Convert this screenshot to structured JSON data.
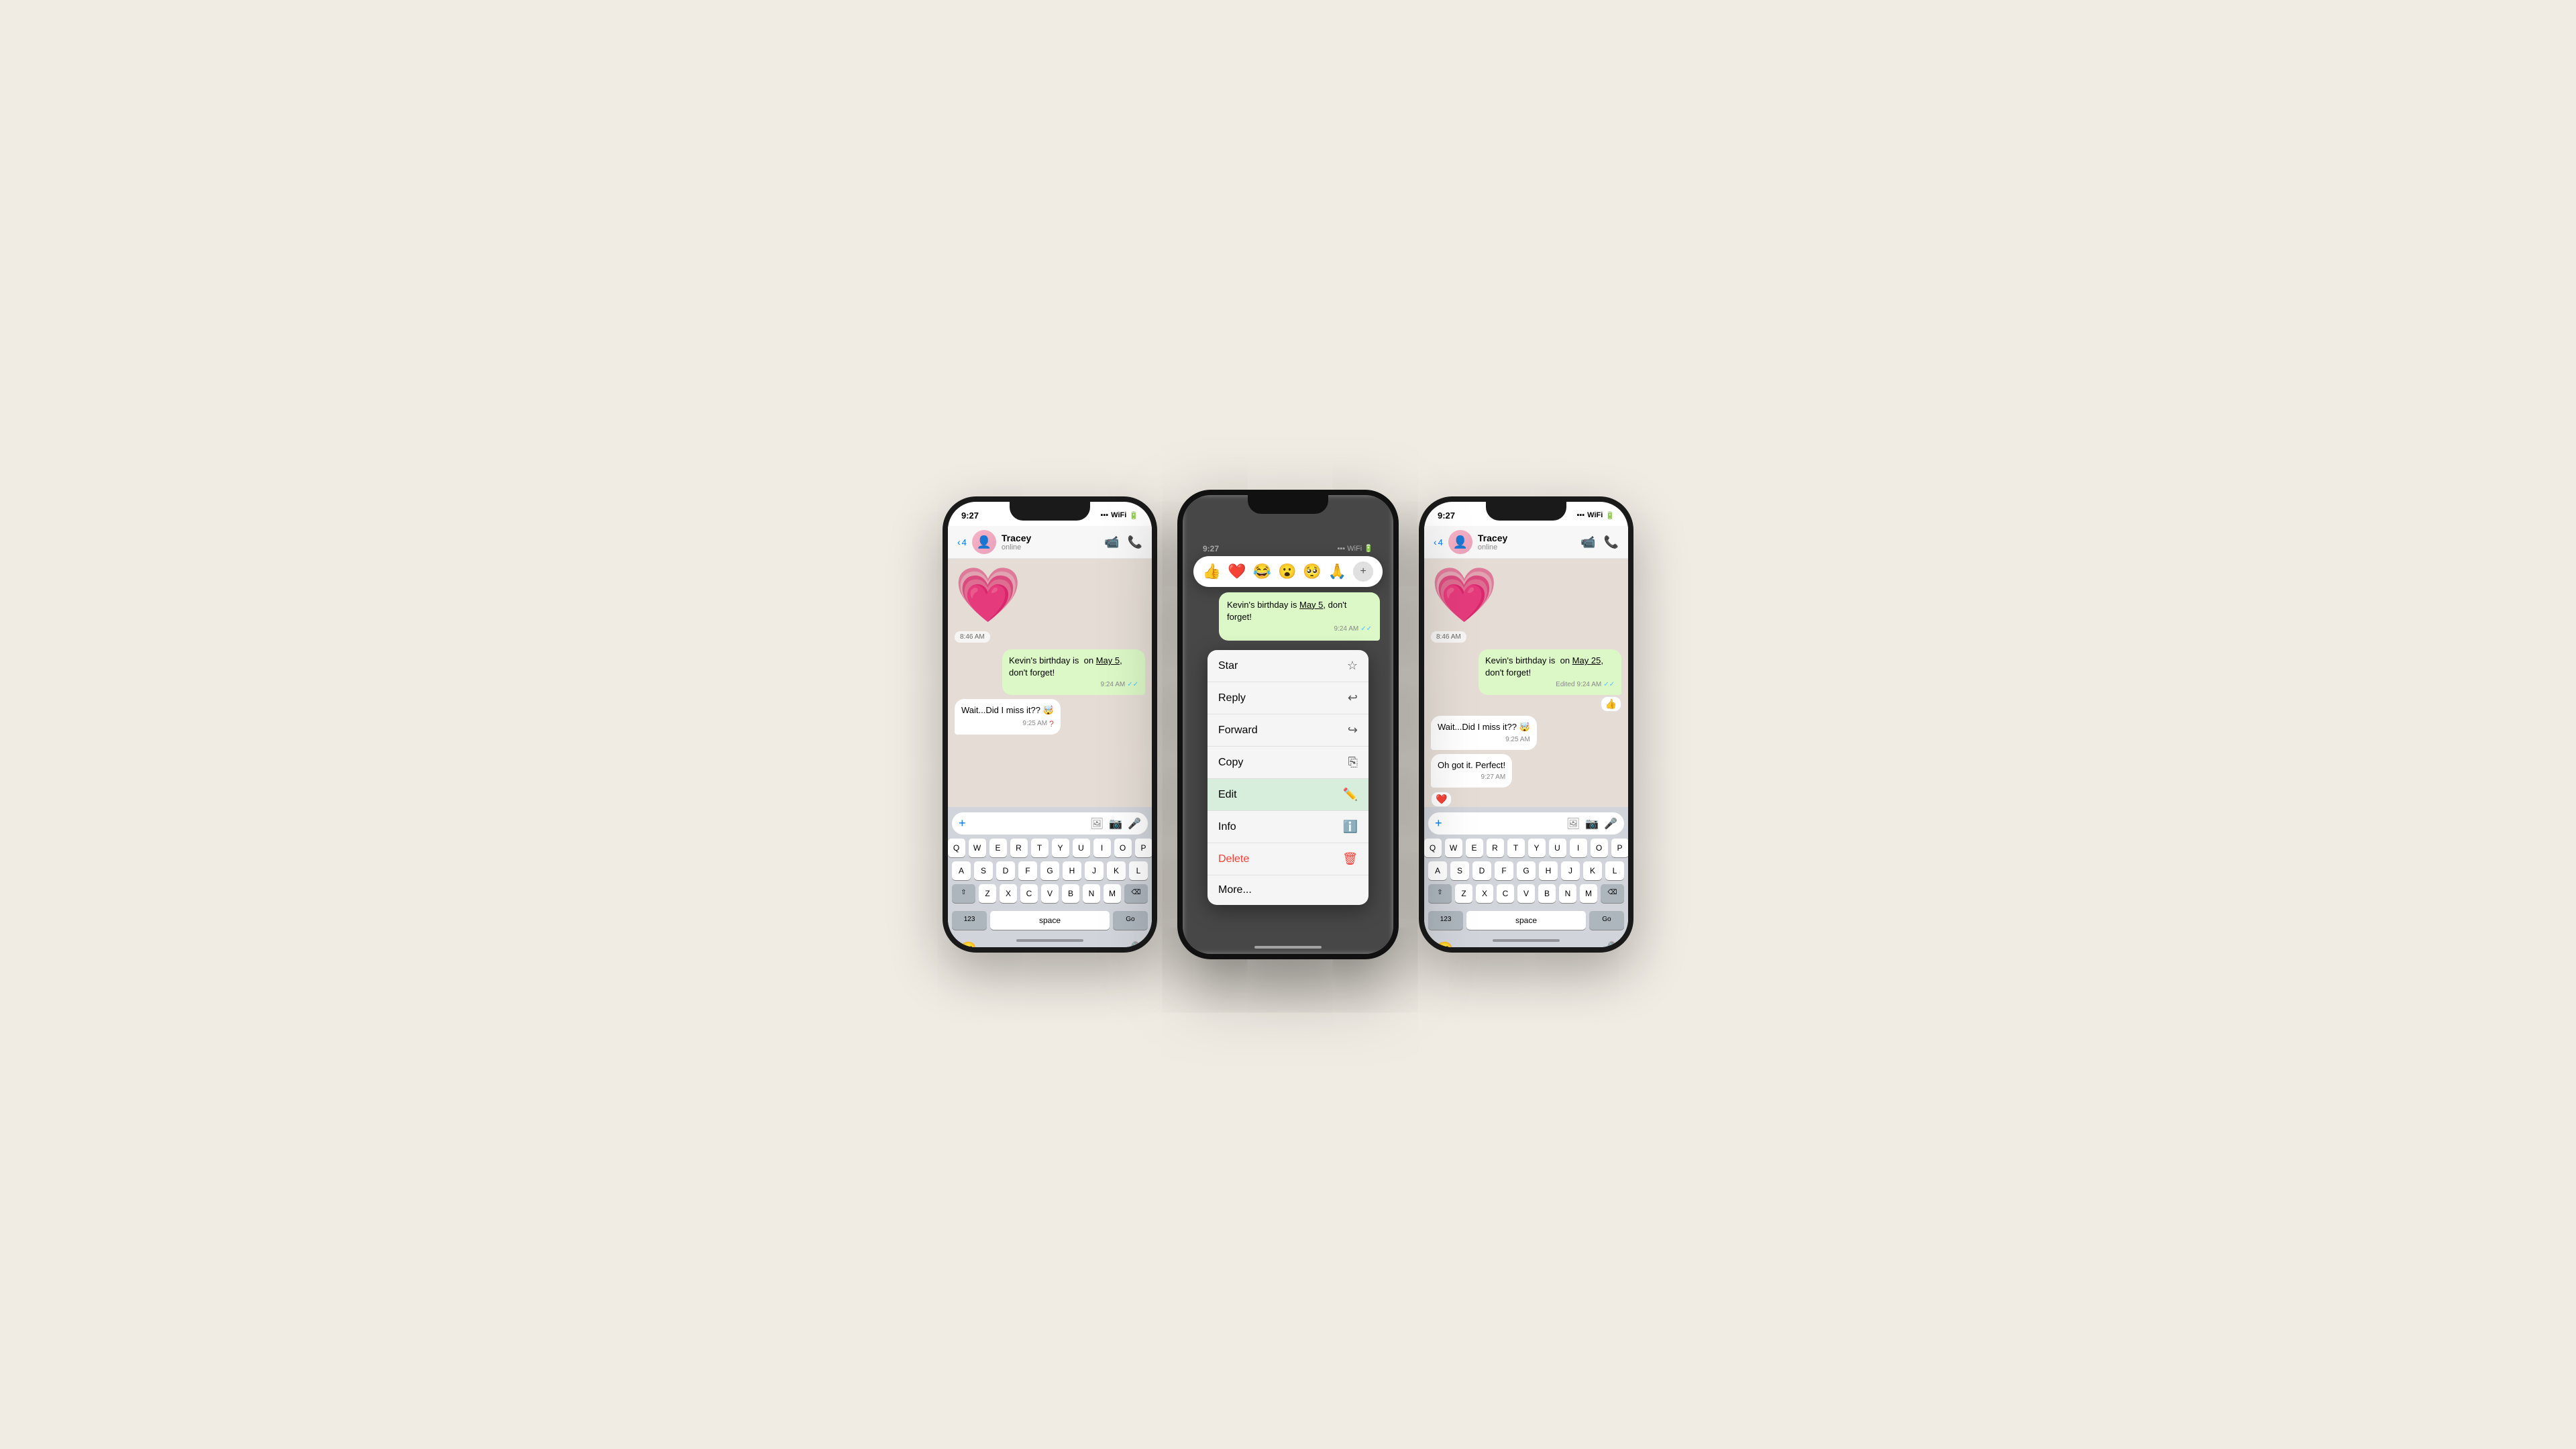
{
  "background_color": "#f0ebe3",
  "phones": {
    "left": {
      "status_time": "9:27",
      "status_icons": "▪▪▪ ▲ ▐▌",
      "back_count": "4",
      "contact_name": "Tracey",
      "contact_status": "online",
      "sticker_emoji": "💗",
      "time_badge": "8:46 AM",
      "messages": [
        {
          "type": "out",
          "text": "Kevin's birthday is  on May 5, don't forget!",
          "time": "9:24 AM",
          "has_check": true
        },
        {
          "type": "in",
          "text": "Wait...Did I miss it?? 🤯",
          "time": "9:25 AM"
        }
      ],
      "keyboard": {
        "row1": [
          "Q",
          "W",
          "E",
          "R",
          "T",
          "Y",
          "U",
          "I",
          "O",
          "P"
        ],
        "row2": [
          "A",
          "S",
          "D",
          "F",
          "G",
          "H",
          "J",
          "K",
          "L"
        ],
        "row3": [
          "⇧",
          "Z",
          "X",
          "C",
          "V",
          "B",
          "N",
          "M",
          "⌫"
        ],
        "bottom": [
          "123",
          "space",
          "Go"
        ]
      }
    },
    "middle": {
      "status_time": "",
      "emoji_reactions": [
        "👍",
        "❤️",
        "😂",
        "😮",
        "🥺",
        "🙏"
      ],
      "message_text": "Kevin's birthday is May 5, don't forget!",
      "message_time": "9:24 AM",
      "menu_items": [
        {
          "label": "Star",
          "icon": "☆",
          "color": "normal"
        },
        {
          "label": "Reply",
          "icon": "↩",
          "color": "normal"
        },
        {
          "label": "Forward",
          "icon": "↪",
          "color": "normal"
        },
        {
          "label": "Copy",
          "icon": "📋",
          "color": "normal"
        },
        {
          "label": "Edit",
          "icon": "✏️",
          "color": "green",
          "highlighted": true
        },
        {
          "label": "Info",
          "icon": "ℹ️",
          "color": "normal"
        },
        {
          "label": "Delete",
          "icon": "🗑️",
          "color": "red"
        },
        {
          "label": "More...",
          "icon": "",
          "color": "normal"
        }
      ]
    },
    "right": {
      "status_time": "9:27",
      "status_icons": "▪▪▪ ▲ ▐▌",
      "back_count": "4",
      "contact_name": "Tracey",
      "contact_status": "online",
      "sticker_emoji": "💗",
      "time_badge": "8:46 AM",
      "messages": [
        {
          "type": "out",
          "text": "Kevin's birthday is  on May 25, don't forget!",
          "time": "Edited 9:24 AM",
          "has_check": true,
          "edited": true
        },
        {
          "type": "in",
          "text": "Wait...Did I miss it?? 🤯",
          "time": "9:25 AM"
        },
        {
          "type": "in",
          "text": "Oh got it. Perfect!",
          "time": "9:27 AM",
          "has_reaction": "❤️"
        }
      ],
      "reaction_on_out": "👍",
      "keyboard": {
        "row1": [
          "Q",
          "W",
          "E",
          "R",
          "T",
          "Y",
          "U",
          "I",
          "O",
          "P"
        ],
        "row2": [
          "A",
          "S",
          "D",
          "F",
          "G",
          "H",
          "J",
          "K",
          "L"
        ],
        "row3": [
          "⇧",
          "Z",
          "X",
          "C",
          "V",
          "B",
          "N",
          "M",
          "⌫"
        ],
        "bottom": [
          "123",
          "space",
          "Go"
        ]
      }
    }
  }
}
